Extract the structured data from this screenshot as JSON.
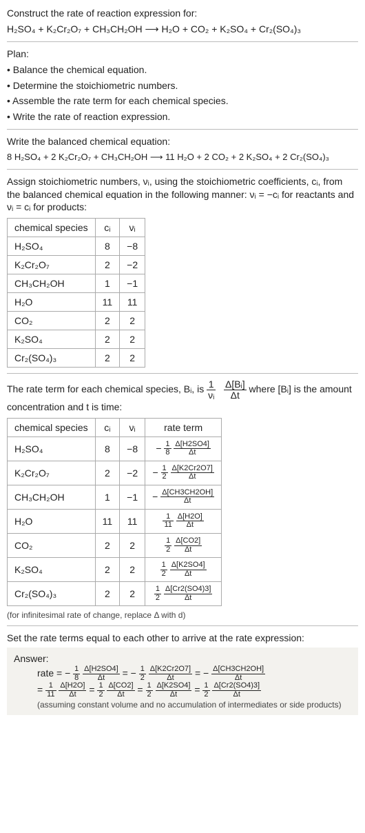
{
  "intro": {
    "title": "Construct the rate of reaction expression for:",
    "equation": "H₂SO₄ + K₂Cr₂O₇ + CH₃CH₂OH  ⟶  H₂O + CO₂ + K₂SO₄ + Cr₂(SO₄)₃"
  },
  "plan": {
    "header": "Plan:",
    "b1": "• Balance the chemical equation.",
    "b2": "• Determine the stoichiometric numbers.",
    "b3": "• Assemble the rate term for each chemical species.",
    "b4": "• Write the rate of reaction expression."
  },
  "balanced": {
    "header": "Write the balanced chemical equation:",
    "equation": "8 H₂SO₄ + 2 K₂Cr₂O₇ + CH₃CH₂OH  ⟶  11 H₂O + 2 CO₂ + 2 K₂SO₄ + 2 Cr₂(SO₄)₃"
  },
  "assign_text": "Assign stoichiometric numbers, νᵢ, using the stoichiometric coefficients, cᵢ, from the balanced chemical equation in the following manner: νᵢ = −cᵢ for reactants and νᵢ = cᵢ for products:",
  "table1": {
    "h1": "chemical species",
    "h2": "cᵢ",
    "h3": "νᵢ",
    "r1c1": "H₂SO₄",
    "r1c2": "8",
    "r1c3": "−8",
    "r2c1": "K₂Cr₂O₇",
    "r2c2": "2",
    "r2c3": "−2",
    "r3c1": "CH₃CH₂OH",
    "r3c2": "1",
    "r3c3": "−1",
    "r4c1": "H₂O",
    "r4c2": "11",
    "r4c3": "11",
    "r5c1": "CO₂",
    "r5c2": "2",
    "r5c3": "2",
    "r6c1": "K₂SO₄",
    "r6c2": "2",
    "r6c3": "2",
    "r7c1": "Cr₂(SO₄)₃",
    "r7c2": "2",
    "r7c3": "2"
  },
  "rate_term_text": {
    "pre": "The rate term for each chemical species, Bᵢ, is ",
    "frac1_num": "1",
    "frac1_den": "νᵢ",
    "frac2_num": "Δ[Bᵢ]",
    "frac2_den": "Δt",
    "post": " where [Bᵢ] is the amount concentration and t is time:"
  },
  "table2": {
    "h1": "chemical species",
    "h2": "cᵢ",
    "h3": "νᵢ",
    "h4": "rate term",
    "r1c1": "H₂SO₄",
    "r1c2": "8",
    "r1c3": "−8",
    "r1_pre": "−",
    "r1_f1n": "1",
    "r1_f1d": "8",
    "r1_f2n": "Δ[H2SO4]",
    "r1_f2d": "Δt",
    "r2c1": "K₂Cr₂O₇",
    "r2c2": "2",
    "r2c3": "−2",
    "r2_pre": "−",
    "r2_f1n": "1",
    "r2_f1d": "2",
    "r2_f2n": "Δ[K2Cr2O7]",
    "r2_f2d": "Δt",
    "r3c1": "CH₃CH₂OH",
    "r3c2": "1",
    "r3c3": "−1",
    "r3_pre": "−",
    "r3_f1n": "",
    "r3_f1d": "",
    "r3_f2n": "Δ[CH3CH2OH]",
    "r3_f2d": "Δt",
    "r4c1": "H₂O",
    "r4c2": "11",
    "r4c3": "11",
    "r4_pre": "",
    "r4_f1n": "1",
    "r4_f1d": "11",
    "r4_f2n": "Δ[H2O]",
    "r4_f2d": "Δt",
    "r5c1": "CO₂",
    "r5c2": "2",
    "r5c3": "2",
    "r5_pre": "",
    "r5_f1n": "1",
    "r5_f1d": "2",
    "r5_f2n": "Δ[CO2]",
    "r5_f2d": "Δt",
    "r6c1": "K₂SO₄",
    "r6c2": "2",
    "r6c3": "2",
    "r6_pre": "",
    "r6_f1n": "1",
    "r6_f1d": "2",
    "r6_f2n": "Δ[K2SO4]",
    "r6_f2d": "Δt",
    "r7c1": "Cr₂(SO₄)₃",
    "r7c2": "2",
    "r7c3": "2",
    "r7_pre": "",
    "r7_f1n": "1",
    "r7_f1d": "2",
    "r7_f2n": "Δ[Cr2(SO4)3]",
    "r7_f2d": "Δt"
  },
  "note_infinitesimal": "(for infinitesimal rate of change, replace Δ with d)",
  "set_equal": "Set the rate terms equal to each other to arrive at the rate expression:",
  "answer": {
    "label": "Answer:",
    "line1_lead": "rate = −",
    "l1_f1n": "1",
    "l1_f1d": "8",
    "l1_f2n": "Δ[H2SO4]",
    "l1_f2d": "Δt",
    "eq1": " = −",
    "l1_f3n": "1",
    "l1_f3d": "2",
    "l1_f4n": "Δ[K2Cr2O7]",
    "l1_f4d": "Δt",
    "eq2": " = −",
    "l1_f5n": "Δ[CH3CH2OH]",
    "l1_f5d": "Δt",
    "line2_lead": "= ",
    "l2_f1n": "1",
    "l2_f1d": "11",
    "l2_f2n": "Δ[H2O]",
    "l2_f2d": "Δt",
    "eq3": " = ",
    "l2_f3n": "1",
    "l2_f3d": "2",
    "l2_f4n": "Δ[CO2]",
    "l2_f4d": "Δt",
    "eq4": " = ",
    "l2_f5n": "1",
    "l2_f5d": "2",
    "l2_f6n": "Δ[K2SO4]",
    "l2_f6d": "Δt",
    "eq5": " = ",
    "l2_f7n": "1",
    "l2_f7d": "2",
    "l2_f8n": "Δ[Cr2(SO4)3]",
    "l2_f8d": "Δt",
    "footnote": "(assuming constant volume and no accumulation of intermediates or side products)"
  }
}
